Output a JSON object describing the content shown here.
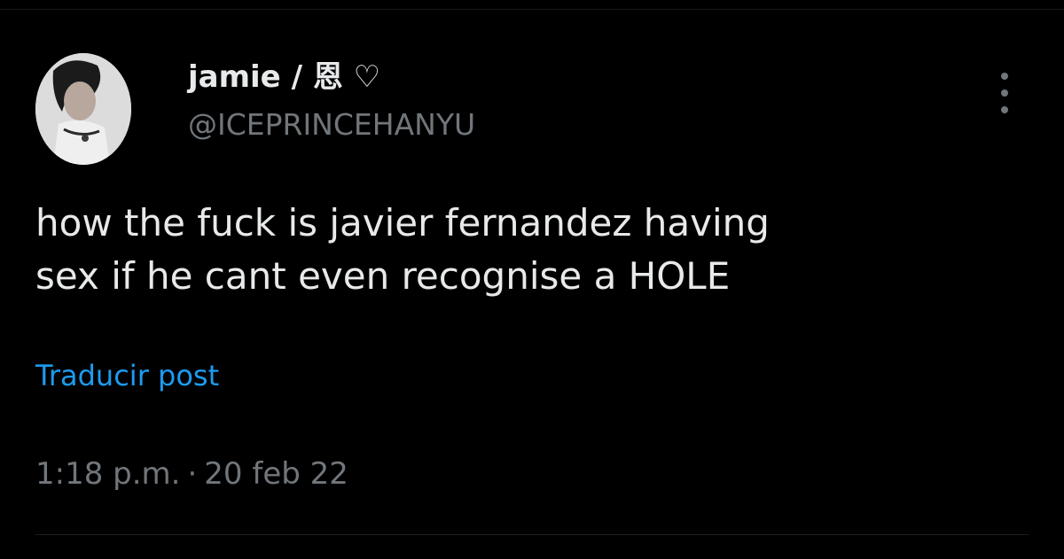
{
  "post": {
    "author": {
      "display_name": "jamie / 恩 ♡",
      "handle": "@ICEPRINCEHANYU",
      "avatar_icon": "profile-photo"
    },
    "text_lines": [
      "how the fuck is javier fernandez having",
      "sex if he cant even recognise a HOLE"
    ],
    "translate_label": "Traducir post",
    "time": "1:18 p.m.",
    "separator": "·",
    "date": "20 feb 22",
    "more_icon": "more-vertical-icon"
  },
  "colors": {
    "background": "#000000",
    "primary_text": "#e7e9ea",
    "secondary_text": "#71767b",
    "link": "#1d9bf0"
  }
}
